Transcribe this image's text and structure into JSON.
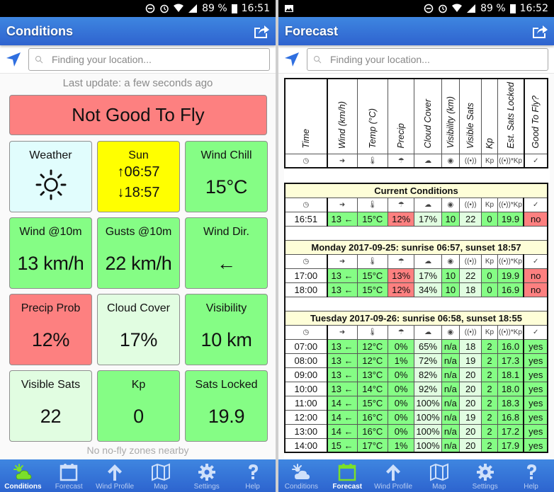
{
  "left_screen": {
    "statusbar": {
      "battery": "89 %",
      "time": "16:51"
    },
    "appbar": {
      "title": "Conditions",
      "share_icon": "share-icon"
    },
    "search": {
      "placeholder": "Finding your location..."
    },
    "last_update": "Last update: a few seconds ago",
    "verdict": {
      "text": "Not Good To Fly",
      "color": "#fd8080"
    },
    "tiles": [
      {
        "label": "Weather",
        "value": "",
        "icon": "sun-icon",
        "color": "#e1fdfd"
      },
      {
        "label": "Sun",
        "sunrise": "↑06:57",
        "sunset": "↓18:57",
        "color": "#ffff00"
      },
      {
        "label": "Wind Chill",
        "value": "15°C",
        "color": "#85fd85"
      },
      {
        "label": "Wind @10m",
        "value": "13 km/h",
        "color": "#85fd85"
      },
      {
        "label": "Gusts @10m",
        "value": "22 km/h",
        "color": "#85fd85"
      },
      {
        "label": "Wind Dir.",
        "value": "←",
        "color": "#85fd85"
      },
      {
        "label": "Precip Prob",
        "value": "12%",
        "color": "#fd8080"
      },
      {
        "label": "Cloud Cover",
        "value": "17%",
        "color": "#e1fde1"
      },
      {
        "label": "Visibility",
        "value": "10 km",
        "color": "#85fd85"
      },
      {
        "label": "Visible Sats",
        "value": "22",
        "color": "#e1fde1"
      },
      {
        "label": "Kp",
        "value": "0",
        "color": "#85fd85"
      },
      {
        "label": "Sats Locked",
        "value": "19.9",
        "color": "#85fd85"
      }
    ],
    "no_fly": "No no-fly zones nearby",
    "active_tab": "Conditions"
  },
  "right_screen": {
    "statusbar": {
      "battery": "89 %",
      "time": "16:52"
    },
    "appbar": {
      "title": "Forecast",
      "share_icon": "share-icon"
    },
    "search": {
      "placeholder": "Finding your location..."
    },
    "active_tab": "Forecast",
    "columns": [
      "Time",
      "Wind (km/h)",
      "Temp (°C)",
      "Precip",
      "Cloud Cover",
      "Visibility (km)",
      "Visible Sats",
      "Kp",
      "Est. Sats Locked",
      "Good To Fly?"
    ],
    "column_icons": [
      "◷",
      "➜",
      "🌡",
      "☂",
      "☁",
      "◉",
      "((•))",
      "Kp",
      "((•))*Kp",
      "✓"
    ],
    "sections": [
      {
        "title": "Current Conditions",
        "rows": [
          {
            "cells": [
              "16:51",
              "13 ←",
              "15°C",
              "12%",
              "17%",
              "10",
              "22",
              "0",
              "19.9",
              "no"
            ],
            "colors": [
              "w",
              "g",
              "g",
              "r",
              "lg",
              "g",
              "lg",
              "g",
              "g",
              "r"
            ]
          }
        ]
      },
      {
        "title": "Monday 2017-09-25: sunrise 06:57, sunset 18:57",
        "rows": [
          {
            "cells": [
              "17:00",
              "13 ←",
              "15°C",
              "13%",
              "17%",
              "10",
              "22",
              "0",
              "19.9",
              "no"
            ],
            "colors": [
              "w",
              "g",
              "g",
              "r",
              "lg",
              "g",
              "lg",
              "g",
              "g",
              "r"
            ]
          },
          {
            "cells": [
              "18:00",
              "13 ←",
              "15°C",
              "12%",
              "34%",
              "10",
              "18",
              "0",
              "16.9",
              "no"
            ],
            "colors": [
              "w",
              "g",
              "g",
              "r",
              "lg",
              "g",
              "lg",
              "g",
              "g",
              "r"
            ]
          }
        ]
      },
      {
        "title": "Tuesday 2017-09-26: sunrise 06:58, sunset 18:55",
        "rows": [
          {
            "cells": [
              "07:00",
              "13 ←",
              "12°C",
              "0%",
              "65%",
              "n/a",
              "18",
              "2",
              "16.0",
              "yes"
            ],
            "colors": [
              "w",
              "g",
              "g",
              "g",
              "lg",
              "g",
              "lg",
              "g",
              "g",
              "g"
            ]
          },
          {
            "cells": [
              "08:00",
              "13 ←",
              "12°C",
              "1%",
              "72%",
              "n/a",
              "19",
              "2",
              "17.3",
              "yes"
            ],
            "colors": [
              "w",
              "g",
              "g",
              "g",
              "lg",
              "g",
              "lg",
              "g",
              "g",
              "g"
            ]
          },
          {
            "cells": [
              "09:00",
              "13 ←",
              "13°C",
              "0%",
              "82%",
              "n/a",
              "20",
              "2",
              "18.1",
              "yes"
            ],
            "colors": [
              "w",
              "g",
              "g",
              "g",
              "lg",
              "g",
              "lg",
              "g",
              "g",
              "g"
            ]
          },
          {
            "cells": [
              "10:00",
              "13 ←",
              "14°C",
              "0%",
              "92%",
              "n/a",
              "20",
              "2",
              "18.0",
              "yes"
            ],
            "colors": [
              "w",
              "g",
              "g",
              "g",
              "lg",
              "g",
              "lg",
              "g",
              "g",
              "g"
            ]
          },
          {
            "cells": [
              "11:00",
              "14 ←",
              "15°C",
              "0%",
              "100%",
              "n/a",
              "20",
              "2",
              "18.3",
              "yes"
            ],
            "colors": [
              "w",
              "g",
              "g",
              "g",
              "lg",
              "g",
              "lg",
              "g",
              "g",
              "g"
            ]
          },
          {
            "cells": [
              "12:00",
              "14 ←",
              "16°C",
              "0%",
              "100%",
              "n/a",
              "19",
              "2",
              "16.8",
              "yes"
            ],
            "colors": [
              "w",
              "g",
              "g",
              "g",
              "lg",
              "g",
              "lg",
              "g",
              "g",
              "g"
            ]
          },
          {
            "cells": [
              "13:00",
              "14 ←",
              "16°C",
              "0%",
              "100%",
              "n/a",
              "20",
              "2",
              "17.2",
              "yes"
            ],
            "colors": [
              "w",
              "g",
              "g",
              "g",
              "lg",
              "g",
              "lg",
              "g",
              "g",
              "g"
            ]
          },
          {
            "cells": [
              "14:00",
              "15 ←",
              "17°C",
              "1%",
              "100%",
              "n/a",
              "20",
              "2",
              "17.9",
              "yes"
            ],
            "colors": [
              "w",
              "g",
              "g",
              "g",
              "lg",
              "g",
              "lg",
              "g",
              "g",
              "g"
            ]
          }
        ]
      }
    ]
  },
  "nav": [
    {
      "label": "Conditions",
      "icon": "weather-icon"
    },
    {
      "label": "Forecast",
      "icon": "calendar-icon"
    },
    {
      "label": "Wind Profile",
      "icon": "arrow-up-icon"
    },
    {
      "label": "Map",
      "icon": "map-icon"
    },
    {
      "label": "Settings",
      "icon": "gear-icon"
    },
    {
      "label": "Help",
      "icon": "help-icon"
    }
  ],
  "colors": {
    "good": "#85fd85",
    "ok": "#e1fde1",
    "bad": "#fd8080",
    "section_header": "#fefed8",
    "appbar": "#3a78dc"
  }
}
